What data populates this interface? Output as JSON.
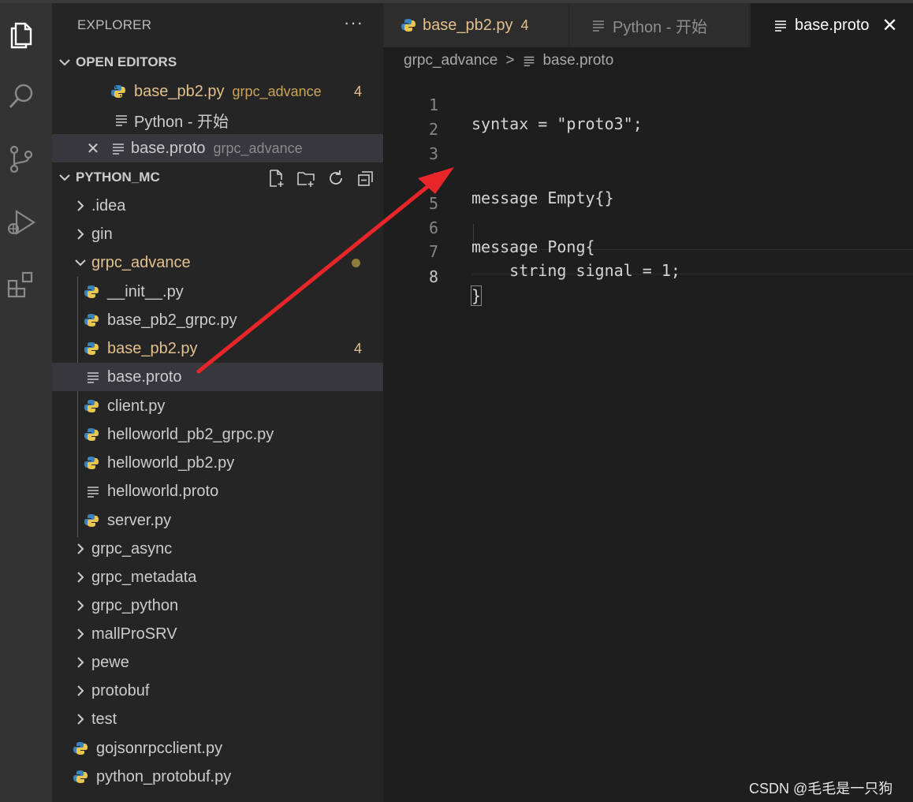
{
  "colors": {
    "accent_modified": "#e2c08d",
    "annotation_arrow": "#e8262a",
    "sidebar_bg": "#252526",
    "editor_bg": "#1e1e1e",
    "activity_bg": "#333333"
  },
  "activity_bar": {
    "icons": [
      "files-icon",
      "search-icon",
      "source-control-icon",
      "run-debug-icon",
      "extensions-icon"
    ]
  },
  "sidebar": {
    "title": "EXPLORER",
    "more": "···",
    "open_editors": {
      "label": "OPEN EDITORS",
      "items": [
        {
          "name": "base_pb2.py",
          "desc": "grpc_advance",
          "badge": "4",
          "icon": "python-icon"
        },
        {
          "name": "Python - 开始",
          "icon": "preview-icon"
        },
        {
          "name": "base.proto",
          "desc": "grpc_advance",
          "icon": "text-file-icon",
          "close": "✕"
        }
      ]
    },
    "workspace": {
      "label": "PYTHON_MC",
      "items": [
        {
          "name": ".idea"
        },
        {
          "name": "gin"
        },
        {
          "name": "grpc_advance"
        },
        {
          "name": "__init__.py"
        },
        {
          "name": "base_pb2_grpc.py"
        },
        {
          "name": "base_pb2.py",
          "badge": "4"
        },
        {
          "name": "base.proto"
        },
        {
          "name": "client.py"
        },
        {
          "name": "helloworld_pb2_grpc.py"
        },
        {
          "name": "helloworld_pb2.py"
        },
        {
          "name": "helloworld.proto"
        },
        {
          "name": "server.py"
        },
        {
          "name": "grpc_async"
        },
        {
          "name": "grpc_metadata"
        },
        {
          "name": "grpc_python"
        },
        {
          "name": "mallProSRV"
        },
        {
          "name": "pewe"
        },
        {
          "name": "protobuf"
        },
        {
          "name": "test"
        },
        {
          "name": "gojsonrpcclient.py"
        },
        {
          "name": "python_protobuf.py"
        }
      ]
    }
  },
  "tabs": [
    {
      "label": "base_pb2.py",
      "badge": "4"
    },
    {
      "label": "Python - 开始"
    },
    {
      "label": "base.proto",
      "close": "✕"
    }
  ],
  "breadcrumb": {
    "folder": "grpc_advance",
    "sep": ">",
    "file": "base.proto"
  },
  "code": {
    "line_numbers": [
      "1",
      "2",
      "3",
      "4",
      "5",
      "6",
      "7",
      "8"
    ],
    "lines": [
      "syntax = \"proto3\";",
      "",
      "",
      "message Empty{}",
      "",
      "message Pong{",
      "    string signal = 1;",
      "}"
    ]
  },
  "watermark": "CSDN @毛毛是一只狗"
}
